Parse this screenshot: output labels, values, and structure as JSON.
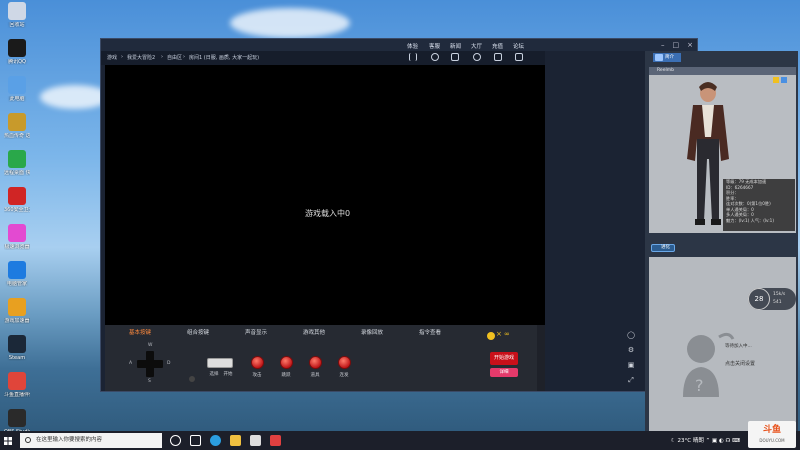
{
  "desktop_icons": [
    {
      "label": "回收站",
      "icon": "recycle-bin-icon",
      "color": "#cfd8e6"
    },
    {
      "label": "腾讯QQ",
      "icon": "qq-penguin-icon",
      "color": "#1a1a1a"
    },
    {
      "label": "此电脑",
      "icon": "computer-icon",
      "color": "#5aa0e6"
    },
    {
      "label": "热血传奇 这一世 快捷方式",
      "icon": "game-shortcut-icon",
      "color": "#c89a2b"
    },
    {
      "label": "远程桌面 快捷方式",
      "icon": "remote-desktop-icon",
      "color": "#2aa84a"
    },
    {
      "label": "360安全卫士 快捷方式",
      "icon": "security-shield-icon",
      "color": "#d02525"
    },
    {
      "label": "极速浏览器",
      "icon": "browser-icon",
      "color": "#e34ad1"
    },
    {
      "label": "电脑管家",
      "icon": "pc-manager-icon",
      "color": "#1e7be0"
    },
    {
      "label": "游戏加速器",
      "icon": "booster-icon",
      "color": "#e8a020"
    },
    {
      "label": "Steam",
      "icon": "steam-icon",
      "color": "#1b2838"
    },
    {
      "label": "斗鱼直播伴侣",
      "icon": "douyu-icon",
      "color": "#e0453a"
    },
    {
      "label": "OBS Studio",
      "icon": "obs-icon",
      "color": "#2a2a2a"
    }
  ],
  "app": {
    "title_menu": [
      "体验",
      "客服",
      "新闻",
      "大厅",
      "充值",
      "论坛"
    ],
    "breadcrumb": [
      "游戏",
      "我爱大冒险2",
      "自由区",
      "房间1 (日服, 画质, 大家一起玩)"
    ],
    "loading_text": "游戏载入中0",
    "control_tabs": [
      "基本按键",
      "组合按键",
      "声音显示",
      "游戏其他",
      "录像回放",
      "指令查看"
    ],
    "active_tab_index": 0,
    "dpad_labels": {
      "up": "W",
      "left": "A",
      "right": "D",
      "down": "S"
    },
    "small_labels": [
      "选择",
      "开始"
    ],
    "red_buttons": [
      "攻击",
      "跳跃",
      "道具",
      "连发"
    ],
    "start_game_label": "开始游戏",
    "pink_button_label": "详细",
    "right_panel": {
      "tab_label": "简介",
      "header_label": "Reelmb",
      "stats": [
        "等级：79 无成本加速",
        "ID：6264667",
        "积分：",
        "胜率：",
        "连对次数：0(第1位0胜)",
        "单人通关局：0",
        "多人通关局：0",
        "魅力：(lv:1)  人气：(lv:1)"
      ],
      "vip_label": "进化",
      "gray_text_1": "等待加入中...",
      "gray_text_2": "点击关闭设置"
    }
  },
  "weather_widget": {
    "temp": "28",
    "line1": "15k/s",
    "line2": "541"
  },
  "taskbar": {
    "search_placeholder": "在这里输入你要搜索的内容",
    "tray_text": "23°C 晴朗",
    "logo_text": "斗鱼",
    "logo_sub": "DOUYU.COM"
  },
  "colors": {
    "accent_red": "#c8101a",
    "active_tab": "#ff8a3d",
    "window_bg": "#1b2333"
  }
}
